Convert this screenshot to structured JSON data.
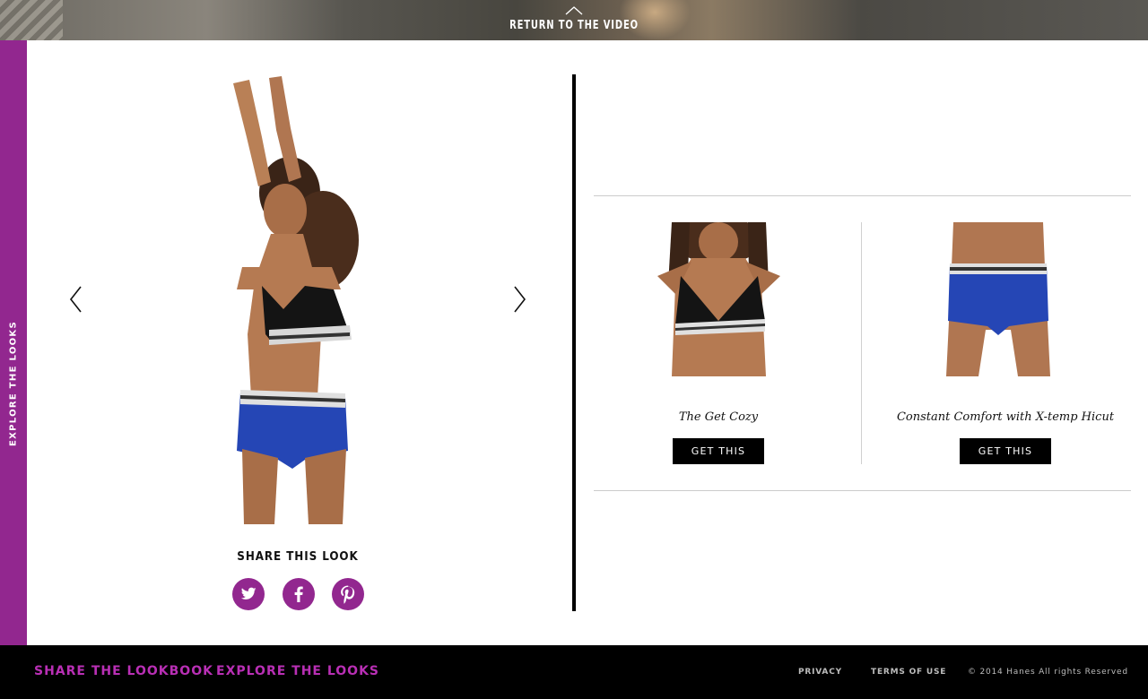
{
  "header": {
    "return_label": "RETURN TO THE VIDEO"
  },
  "side_tab": {
    "label": "EXPLORE THE LOOKS"
  },
  "main": {
    "share_title": "SHARE THIS LOOK",
    "social": [
      "twitter-icon",
      "facebook-icon",
      "pinterest-icon"
    ]
  },
  "products": [
    {
      "name": "The Get Cozy",
      "button": "GET THIS"
    },
    {
      "name": "Constant Comfort with X-temp Hicut",
      "button": "GET THIS"
    }
  ],
  "footer": {
    "share_link": "SHARE THE LOOKBOOK",
    "explore_link": "EXPLORE THE  LOOKS",
    "privacy": "PRIVACY",
    "terms": "TERMS OF USE",
    "copyright": "© 2014 Hanes All rights Reserved"
  },
  "colors": {
    "accent": "#92278f",
    "footer_link": "#b92fb5",
    "black": "#000000"
  }
}
